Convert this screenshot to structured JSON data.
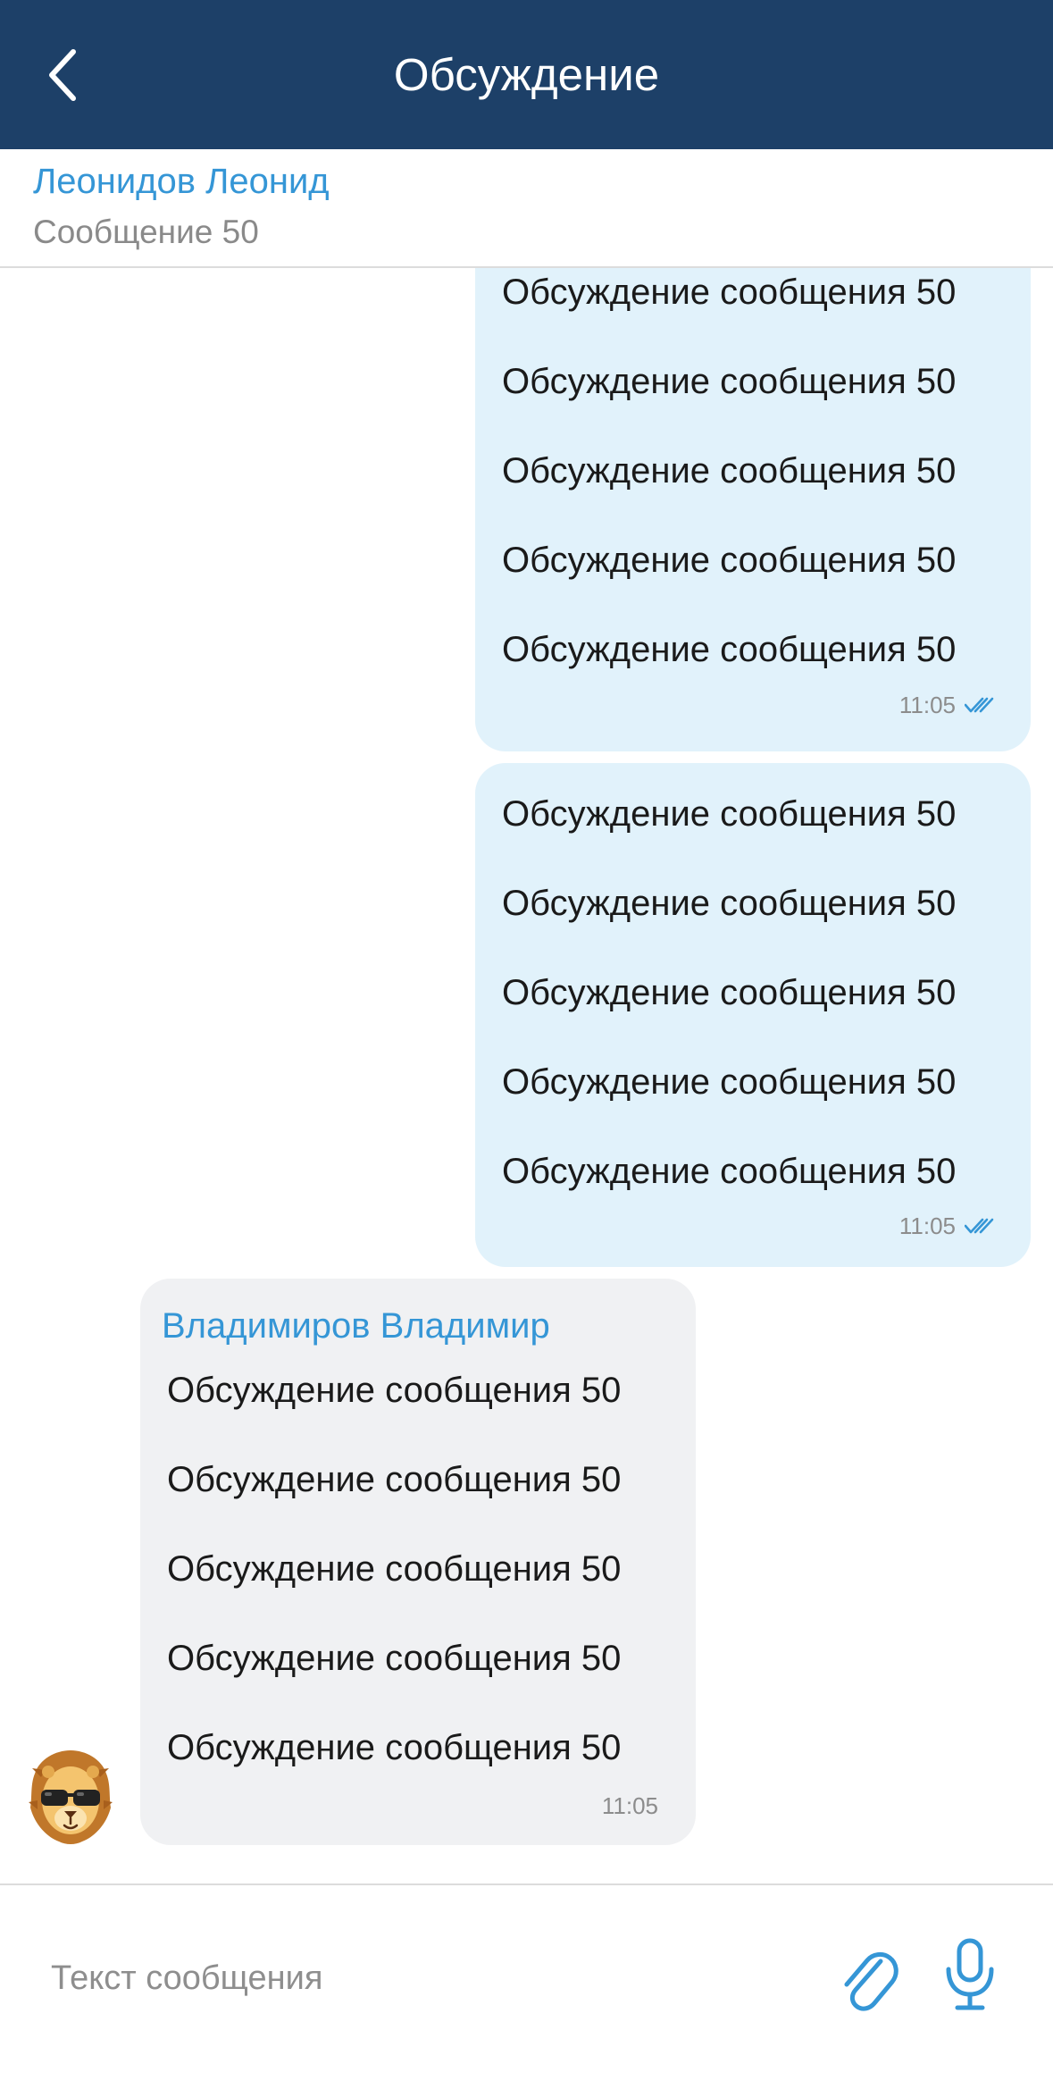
{
  "header": {
    "title": "Обсуждение",
    "back_icon": "chevron-left-icon"
  },
  "parent_message": {
    "author": "Леонидов Леонид",
    "text": "Сообщение 50"
  },
  "messages": [
    {
      "direction": "outgoing",
      "lines": [
        "Обсуждение сообщения 50",
        "Обсуждение сообщения 50",
        "Обсуждение сообщения 50",
        "Обсуждение сообщения 50",
        "Обсуждение сообщения 50"
      ],
      "time": "11:05",
      "status_icon": "double-check-icon"
    },
    {
      "direction": "outgoing",
      "lines": [
        "Обсуждение сообщения 50",
        "Обсуждение сообщения 50",
        "Обсуждение сообщения 50",
        "Обсуждение сообщения 50",
        "Обсуждение сообщения 50"
      ],
      "time": "11:05",
      "status_icon": "double-check-icon"
    },
    {
      "direction": "incoming",
      "sender": "Владимиров Владимир",
      "lines": [
        "Обсуждение сообщения 50",
        "Обсуждение сообщения 50",
        "Обсуждение сообщения 50",
        "Обсуждение сообщения 50",
        "Обсуждение сообщения 50"
      ],
      "time": "11:05",
      "avatar_icon": "lion-with-sunglasses-avatar"
    }
  ],
  "composer": {
    "placeholder": "Текст сообщения",
    "attach_icon": "paperclip-icon",
    "mic_icon": "microphone-icon"
  },
  "colors": {
    "header_bg": "#1d4068",
    "accent": "#3596d6",
    "outgoing_bubble": "#e1f2fb",
    "incoming_bubble": "#f0f1f3"
  }
}
